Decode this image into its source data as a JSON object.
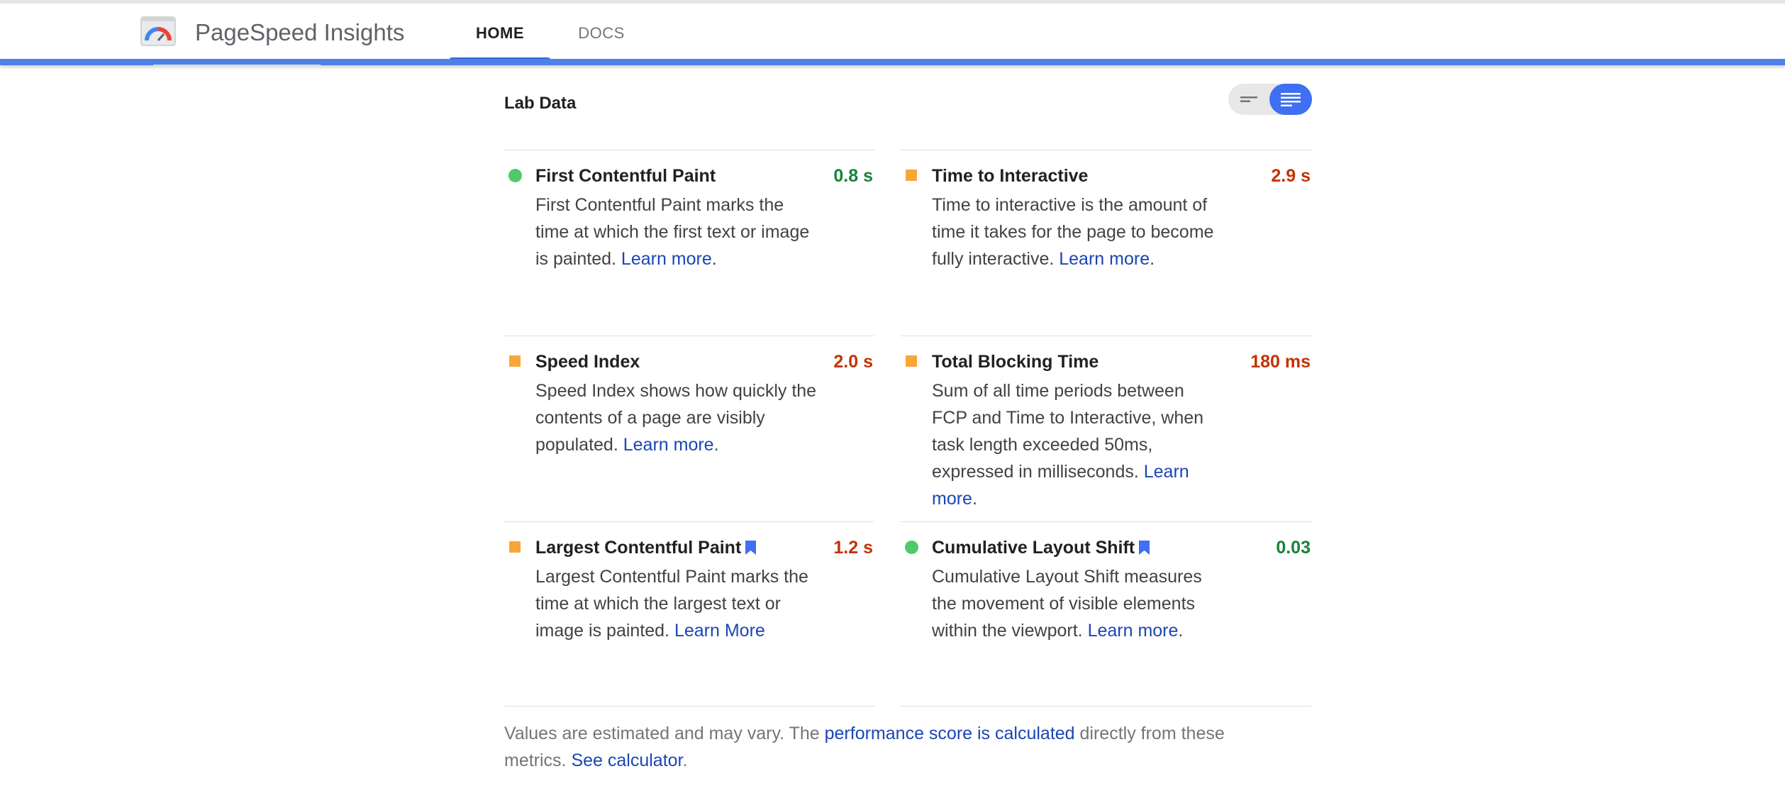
{
  "header": {
    "app_title": "PageSpeed Insights",
    "tabs": [
      {
        "label": "HOME",
        "active": true
      },
      {
        "label": "DOCS",
        "active": false
      }
    ],
    "accent_color": "#4f7fe8"
  },
  "lab": {
    "title": "Lab Data",
    "view_toggle": {
      "options": [
        "summary-view-icon",
        "detailed-view-icon"
      ],
      "selected": "detailed-view-icon"
    }
  },
  "metrics": [
    {
      "name": "First Contentful Paint",
      "value": "0.8 s",
      "status": "good",
      "indicator": "green-circle-icon",
      "description": "First Contentful Paint marks the time at which the first text or image is painted.",
      "link_text": "Learn more",
      "suffix": "."
    },
    {
      "name": "Time to Interactive",
      "value": "2.9 s",
      "status": "average",
      "indicator": "orange-square-icon",
      "description": "Time to interactive is the amount of time it takes for the page to become fully interactive.",
      "link_text": "Learn more",
      "suffix": "."
    },
    {
      "name": "Speed Index",
      "value": "2.0 s",
      "status": "average",
      "indicator": "orange-square-icon",
      "description": "Speed Index shows how quickly the contents of a page are visibly populated.",
      "link_text": "Learn more",
      "suffix": "."
    },
    {
      "name": "Total Blocking Time",
      "value": "180 ms",
      "status": "average",
      "indicator": "orange-square-icon",
      "description": "Sum of all time periods between FCP and Time to Interactive, when task length exceeded 50ms, expressed in milliseconds.",
      "link_text": "Learn more",
      "suffix": "."
    },
    {
      "name": "Largest Contentful Paint",
      "value": "1.2 s",
      "status": "average",
      "indicator": "orange-square-icon",
      "core_web_vital": true,
      "description": "Largest Contentful Paint marks the time at which the largest text or image is painted.",
      "link_text": "Learn More",
      "suffix": ""
    },
    {
      "name": "Cumulative Layout Shift",
      "value": "0.03",
      "status": "good",
      "indicator": "green-circle-icon",
      "core_web_vital": true,
      "description": "Cumulative Layout Shift measures the movement of visible elements within the viewport.",
      "link_text": "Learn more",
      "suffix": "."
    }
  ],
  "footnote": {
    "text_before": "Values are estimated and may vary. The ",
    "link1": "performance score is calculated",
    "text_middle": " directly from these metrics. ",
    "link2": "See calculator",
    "text_after": "."
  },
  "colors": {
    "good": "#178239",
    "average": "#c33300",
    "indicator_good": "#4dcb6a",
    "indicator_average": "#f8a639",
    "link": "#1a46b5",
    "bookmark": "#3f6ff2"
  }
}
